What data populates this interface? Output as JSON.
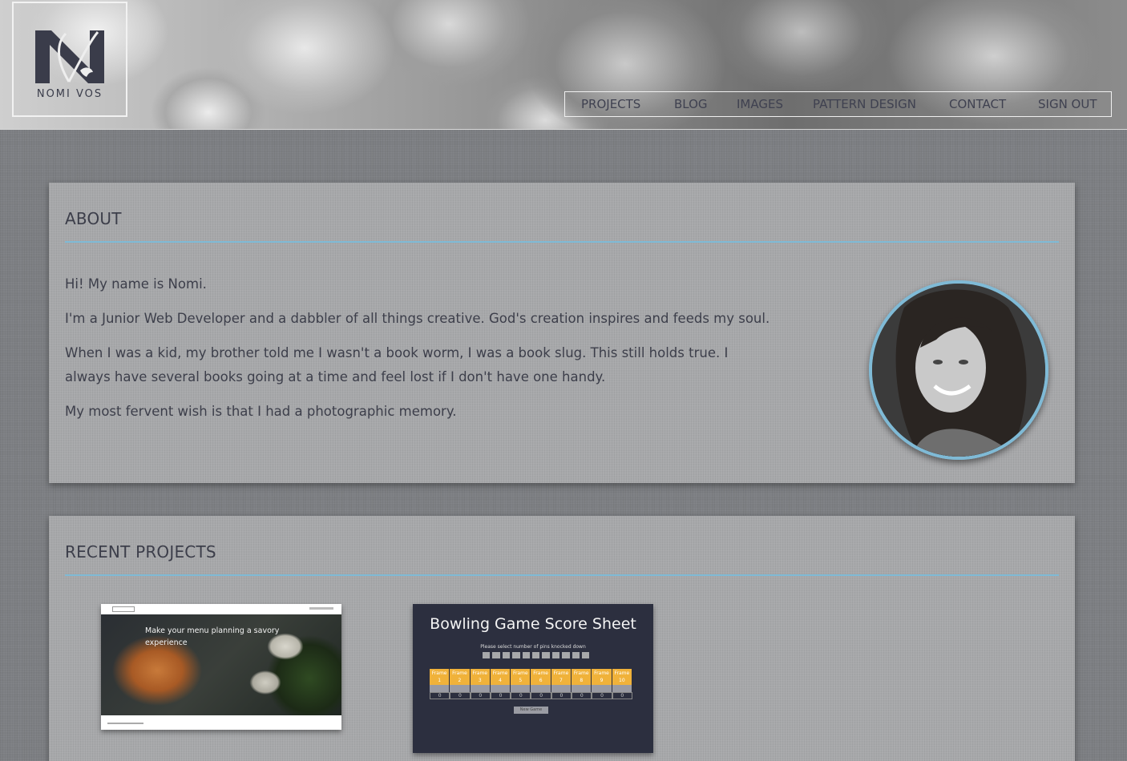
{
  "header": {
    "logo_text": "NOMI VOS",
    "logo_letters": "NV"
  },
  "nav": {
    "items": [
      "PROJECTS",
      "BLOG",
      "IMAGES",
      "PATTERN DESIGN",
      "CONTACT",
      "SIGN OUT"
    ]
  },
  "about": {
    "title": "ABOUT",
    "paragraphs": [
      "Hi! My name is Nomi.",
      "I'm a Junior Web Developer and a dabbler of all things creative. God's creation inspires and feeds my soul.",
      "When I was a kid, my brother told me I wasn't a book worm, I was a book slug. This still holds true. I always have several books going at a time and feel lost if I don't have one handy.",
      "My most fervent wish is that I had a photographic memory."
    ]
  },
  "projects": {
    "title": "RECENT PROJECTS",
    "meal": {
      "headline": "Make your menu planning a savory experience"
    },
    "bowling": {
      "title": "Bowling Game Score Sheet",
      "subtitle": "Please select number of pins knocked down",
      "frames": [
        "Frame 1",
        "Frame 2",
        "Frame 3",
        "Frame 4",
        "Frame 5",
        "Frame 6",
        "Frame 7",
        "Frame 8",
        "Frame 9",
        "Frame 10"
      ],
      "scores": [
        "0",
        "0",
        "0",
        "0",
        "0",
        "0",
        "0",
        "0",
        "0",
        "0"
      ],
      "button": "New Game"
    }
  },
  "colors": {
    "accent": "#7fbad6",
    "text": "#3c3e4a",
    "bowling_orange": "#f0b23a",
    "bowling_bg": "#2c2f3f"
  }
}
